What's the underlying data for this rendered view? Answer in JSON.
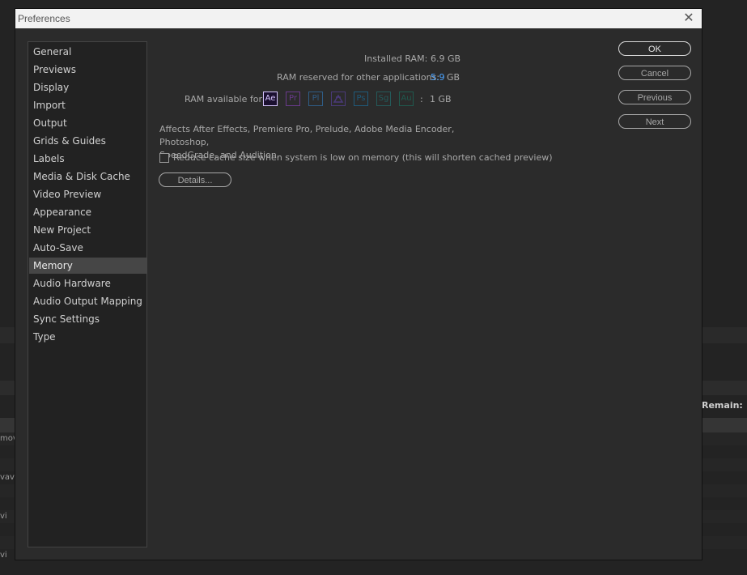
{
  "background": {
    "remain_label": "Remain:",
    "fragments": [
      "mov",
      "vav",
      "vi",
      "vi"
    ]
  },
  "dialog": {
    "title": "Preferences",
    "close_glyph": "✕"
  },
  "sidebar": {
    "items": [
      {
        "label": "General"
      },
      {
        "label": "Previews"
      },
      {
        "label": "Display"
      },
      {
        "label": "Import"
      },
      {
        "label": "Output"
      },
      {
        "label": "Grids & Guides"
      },
      {
        "label": "Labels"
      },
      {
        "label": "Media & Disk Cache"
      },
      {
        "label": "Video Preview"
      },
      {
        "label": "Appearance"
      },
      {
        "label": "New Project"
      },
      {
        "label": "Auto-Save"
      },
      {
        "label": "Memory",
        "selected": true
      },
      {
        "label": "Audio Hardware"
      },
      {
        "label": "Audio Output Mapping"
      },
      {
        "label": "Sync Settings"
      },
      {
        "label": "Type"
      }
    ]
  },
  "memory": {
    "installed_ram_label": "Installed RAM:",
    "installed_ram_value": "6.9 GB",
    "reserved_label": "RAM reserved for other applications:",
    "reserved_value": "5.9",
    "reserved_unit": "GB",
    "available_label": "RAM available for",
    "available_colon": ":",
    "available_value": "1 GB",
    "apps": [
      {
        "abbr": "Ae",
        "name": "after-effects",
        "color": "#d8c6ff",
        "bg": "#1b1030"
      },
      {
        "abbr": "Pr",
        "name": "premiere-pro",
        "color": "#6a3a8c",
        "bg": "#2b2b2b"
      },
      {
        "abbr": "Pl",
        "name": "prelude",
        "color": "#2f5d86",
        "bg": "#2b2b2b"
      },
      {
        "abbr": "Me",
        "name": "media-encoder",
        "color": "#4a3a7a",
        "bg": "#2b2b2b"
      },
      {
        "abbr": "Ps",
        "name": "photoshop",
        "color": "#1f5a7a",
        "bg": "#2b2b2b"
      },
      {
        "abbr": "Sg",
        "name": "speedgrade",
        "color": "#245a5a",
        "bg": "#2b2b2b"
      },
      {
        "abbr": "Au",
        "name": "audition",
        "color": "#1f5a4e",
        "bg": "#2b2b2b"
      }
    ],
    "affects_line1": "Affects After Effects, Premiere Pro, Prelude, Adobe Media Encoder, Photoshop,",
    "affects_line2": "SpeedGrade, and Audition.",
    "reduce_cache_label": "Reduce cache size when system is low on memory (this will shorten cached preview)",
    "reduce_cache_checked": false,
    "details_label": "Details..."
  },
  "buttons": {
    "ok": "OK",
    "cancel": "Cancel",
    "previous": "Previous",
    "next": "Next"
  }
}
